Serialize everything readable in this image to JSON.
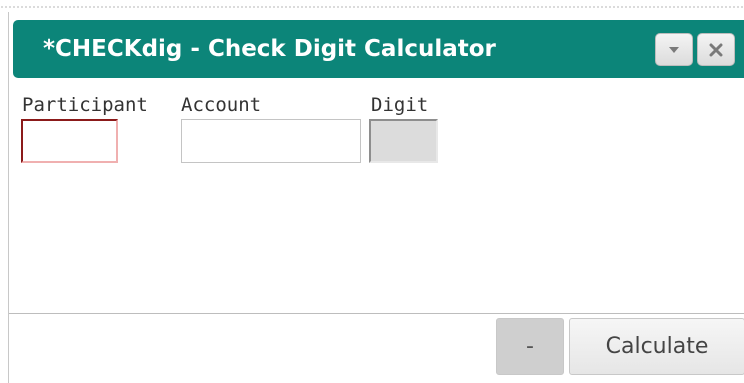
{
  "window": {
    "title": "*CHECKdig - Check Digit Calculator"
  },
  "titlebar_buttons": {
    "menu_icon": "chevron-down-icon",
    "close_icon": "close-icon"
  },
  "fields": {
    "participant": {
      "label": "Participant",
      "value": ""
    },
    "account": {
      "label": "Account",
      "value": ""
    },
    "digit": {
      "label": "Digit",
      "value": ""
    }
  },
  "footer": {
    "minus_label": "-",
    "calculate_label": "Calculate"
  },
  "colors": {
    "titlebar": "#0c8579",
    "participant_border": "#8b1a1a",
    "digit_background": "#dcdcdc"
  }
}
